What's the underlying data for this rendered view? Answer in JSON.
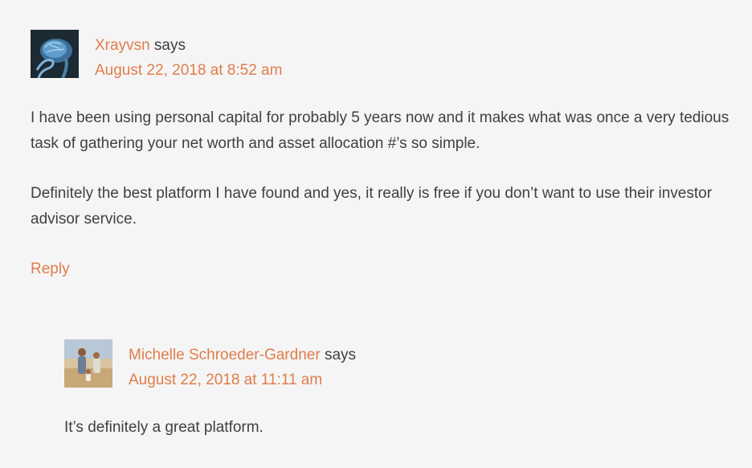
{
  "comments": [
    {
      "author": "Xrayvsn",
      "says": "says",
      "date": "August 22, 2018 at 8:52 am",
      "avatar_icon": "brain-xray-avatar",
      "paragraphs": [
        "I have been using personal capital for probably 5 years now and it makes what was once a very tedious task of gathering your net worth and asset allocation #’s so simple.",
        "Definitely the best platform I have found and yes, it really is free if you don’t want to use their investor advisor service."
      ],
      "reply_label": "Reply"
    },
    {
      "author": "Michelle Schroeder-Gardner",
      "says": "says",
      "date": "August 22, 2018 at 11:11 am",
      "avatar_icon": "family-photo-avatar",
      "paragraphs": [
        "It’s definitely a great platform."
      ]
    }
  ],
  "colors": {
    "link": "#e07d4a",
    "text": "#404040",
    "background": "#f5f5f5"
  }
}
